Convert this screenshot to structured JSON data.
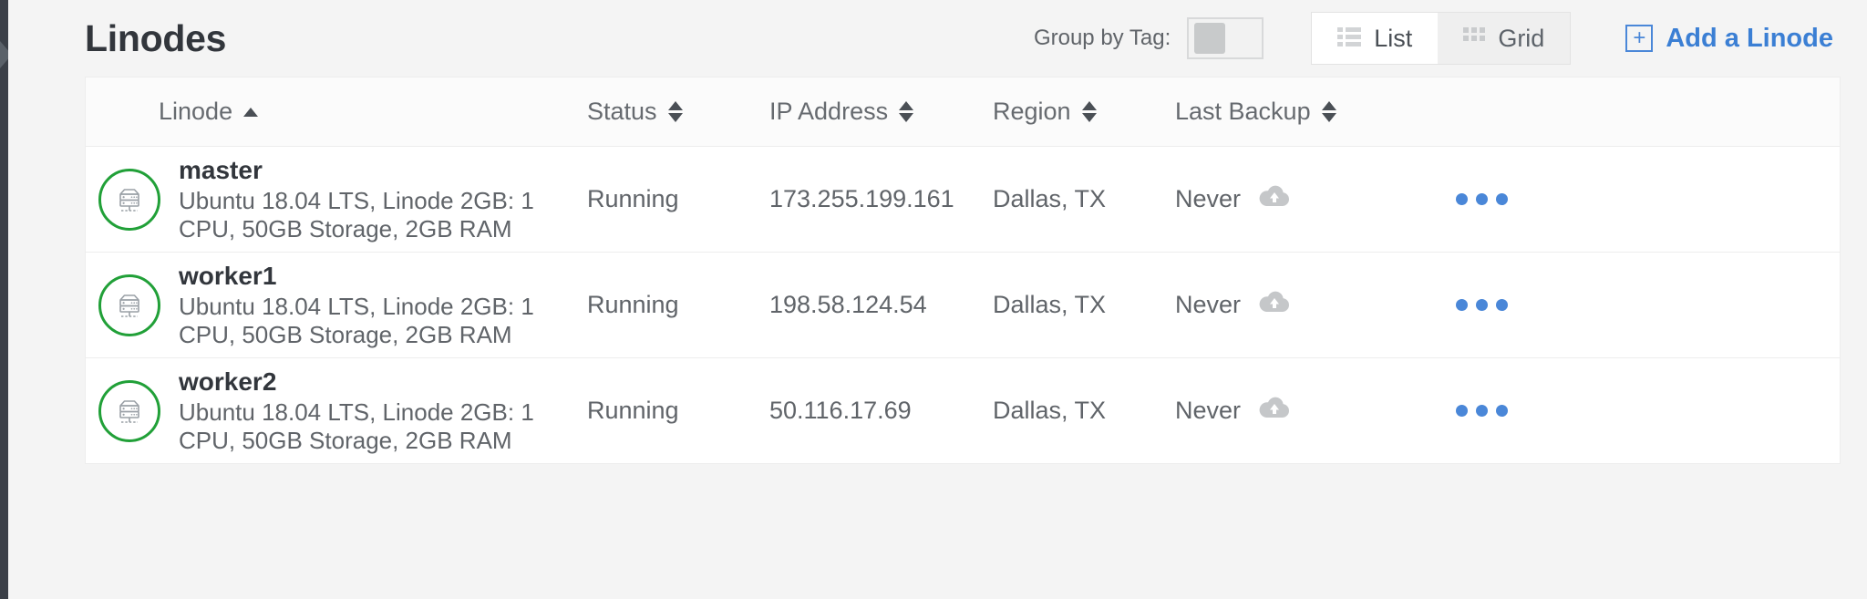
{
  "header": {
    "title": "Linodes",
    "group_by_tag_label": "Group by Tag:",
    "group_by_tag_state": "off",
    "view_list_label": "List",
    "view_grid_label": "Grid",
    "active_view": "List",
    "add_linode_label": "Add a Linode",
    "add_linode_plus": "+"
  },
  "table": {
    "columns": [
      {
        "label": "Linode",
        "sort": "asc"
      },
      {
        "label": "Status",
        "sort": "none"
      },
      {
        "label": "IP Address",
        "sort": "none"
      },
      {
        "label": "Region",
        "sort": "none"
      },
      {
        "label": "Last Backup",
        "sort": "none"
      }
    ],
    "rows": [
      {
        "name": "master",
        "spec": "Ubuntu 18.04 LTS, Linode 2GB: 1 CPU, 50GB Storage, 2GB RAM",
        "status": "Running",
        "ip": "173.255.199.161",
        "region": "Dallas, TX",
        "last_backup": "Never"
      },
      {
        "name": "worker1",
        "spec": "Ubuntu 18.04 LTS, Linode 2GB: 1 CPU, 50GB Storage, 2GB RAM",
        "status": "Running",
        "ip": "198.58.124.54",
        "region": "Dallas, TX",
        "last_backup": "Never"
      },
      {
        "name": "worker2",
        "spec": "Ubuntu 18.04 LTS, Linode 2GB: 1 CPU, 50GB Storage, 2GB RAM",
        "status": "Running",
        "ip": "50.116.17.69",
        "region": "Dallas, TX",
        "last_backup": "Never"
      }
    ]
  },
  "colors": {
    "accent_blue": "#3b7fd4",
    "status_green": "#21a038",
    "text_dark": "#32363c",
    "text_muted": "#606469",
    "page_bg": "#f4f4f4",
    "sidebar_dark": "#3b4048"
  }
}
